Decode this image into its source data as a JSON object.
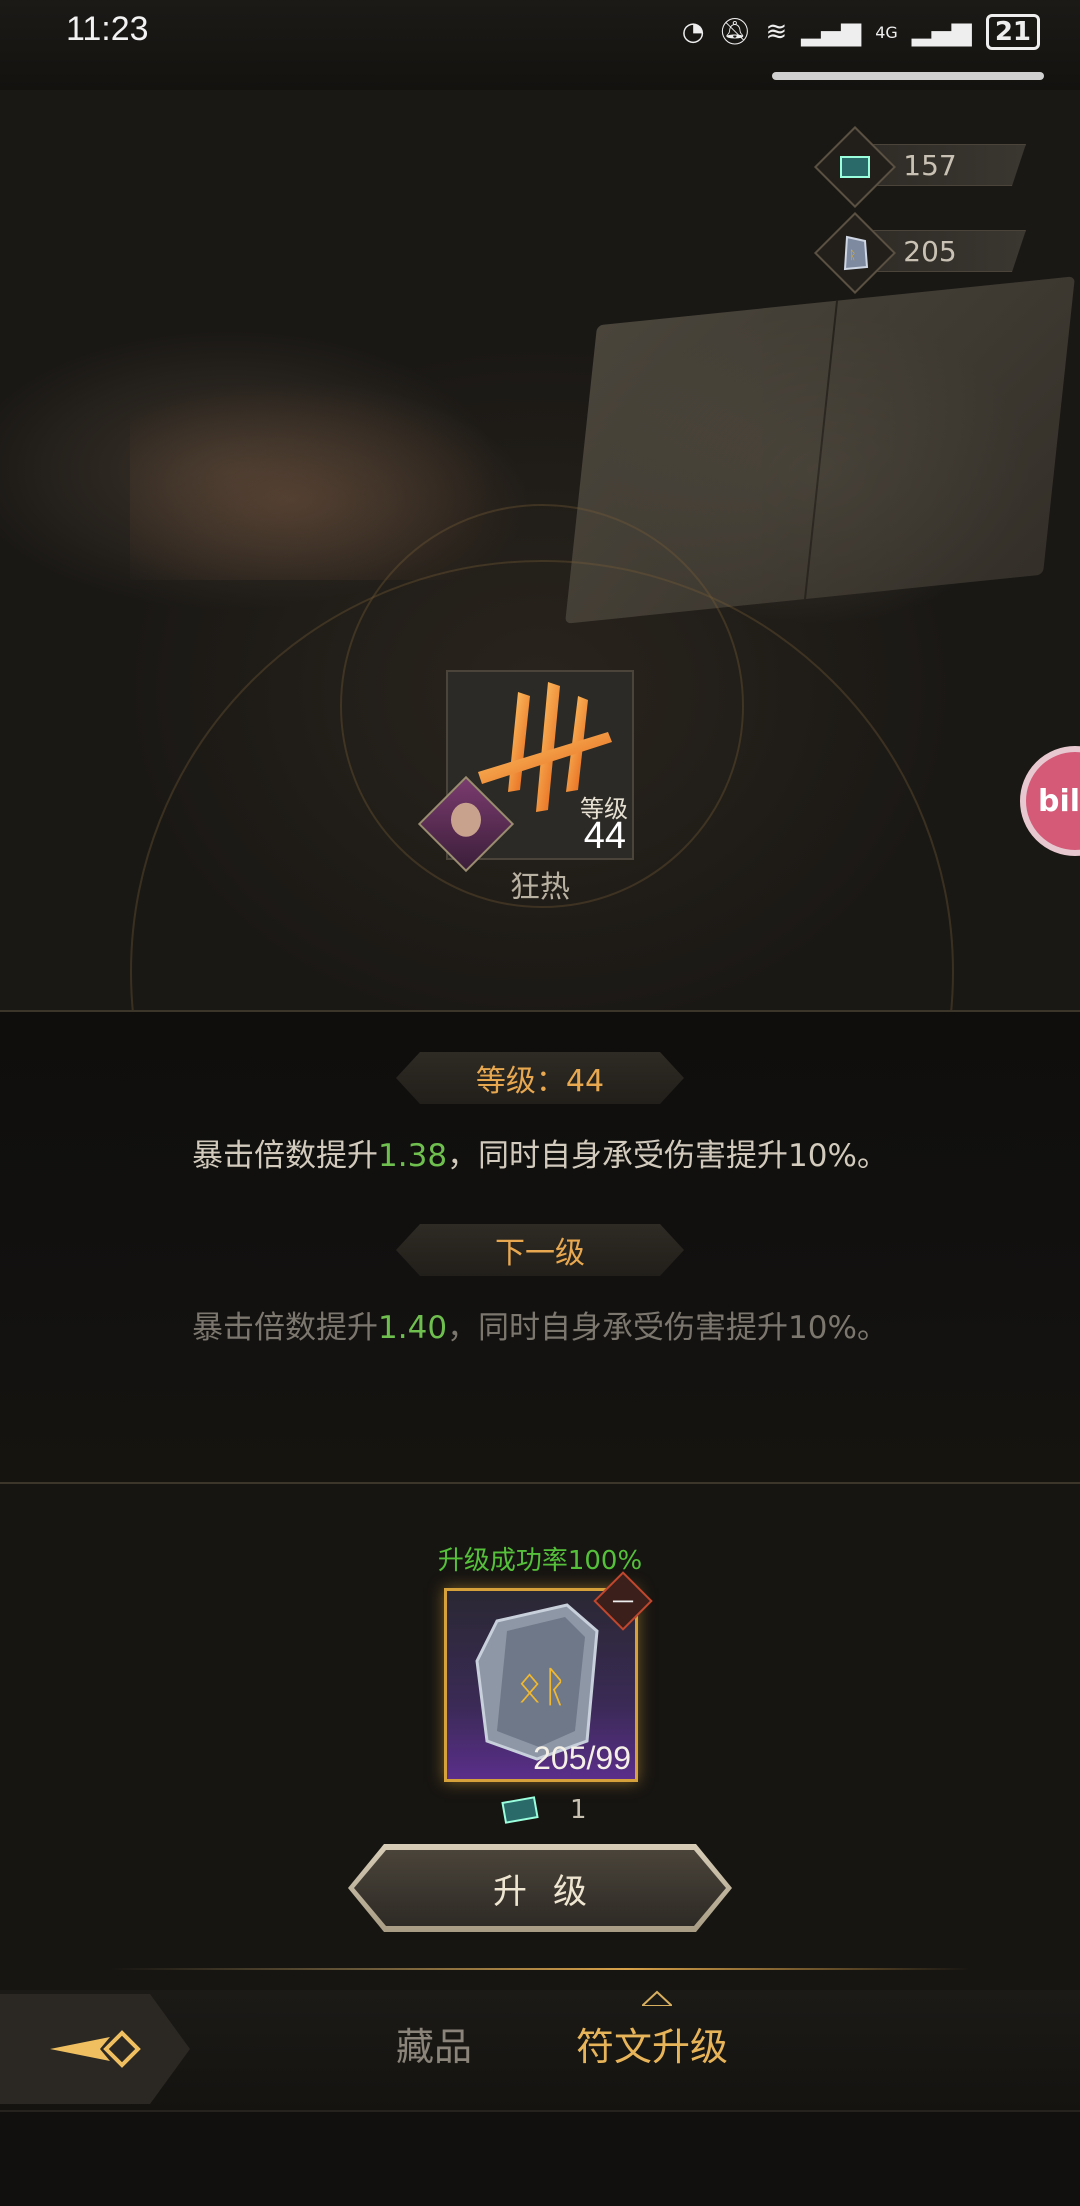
{
  "status_bar": {
    "time": "11:23",
    "network": "4G",
    "battery": "21"
  },
  "currencies": [
    {
      "icon": "book-icon",
      "value": "157"
    },
    {
      "icon": "rune-stone-icon",
      "value": "205"
    }
  ],
  "rune": {
    "level_label": "等级",
    "level_value": "44",
    "name": "狂热"
  },
  "floating_button": {
    "label": "bili"
  },
  "current_level": {
    "badge": "等级：44",
    "desc_prefix": "暴击倍数提升",
    "desc_value": "1.38",
    "desc_suffix": "，同时自身承受伤害提升10%。"
  },
  "next_level": {
    "badge": "下一级",
    "desc_prefix": "暴击倍数提升",
    "desc_value": "1.40",
    "desc_suffix": "，同时自身承受伤害提升10%。"
  },
  "upgrade": {
    "success_rate": "升级成功率100%",
    "material_count": "205/99",
    "remove_symbol": "一",
    "cost_value": "1",
    "button_label": "升级"
  },
  "nav": {
    "tabs": [
      {
        "label": "藏品",
        "active": false
      },
      {
        "label": "符文升级",
        "active": true
      }
    ]
  },
  "colors": {
    "accent_gold": "#e8a850",
    "success_green": "#55c03a",
    "value_green": "#6fbf4f"
  }
}
